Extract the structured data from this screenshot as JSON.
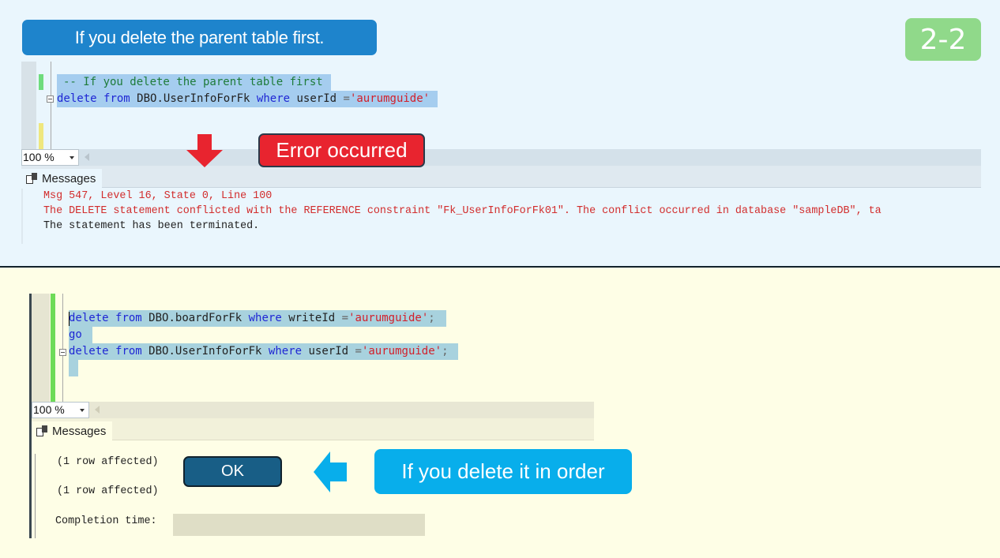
{
  "top": {
    "title": "If you delete the parent table first.",
    "page_badge": "2-2",
    "editor": {
      "line1_comment": "-- If you delete the parent table first",
      "line2": {
        "kw1": "delete",
        "kw2": "from",
        "table": "DBO.UserInfoForFk",
        "kw3": "where",
        "column": "userId",
        "op": "=",
        "value": "'aurumguide'"
      }
    },
    "zoom_level": "100 %",
    "messages_tab": "Messages",
    "messages": [
      {
        "text": "Msg 547, Level 16, State 0, Line 100",
        "type": "error"
      },
      {
        "text": "The DELETE statement conflicted with the REFERENCE constraint \"Fk_UserInfoForFk01\". The conflict occurred in database \"sampleDB\", ta",
        "type": "error"
      },
      {
        "text": "The statement has been terminated.",
        "type": "normal"
      }
    ],
    "callout": "Error occurred",
    "colors": {
      "banner": "#1e84cc",
      "badge": "#90d98a",
      "error": "#e8242f"
    }
  },
  "bottom": {
    "editor": {
      "line1": {
        "kw1": "delete",
        "kw2": "from",
        "table": "DBO.boardForFk",
        "kw3": "where",
        "column": "writeId",
        "op": "=",
        "value": "'aurumguide'",
        "end": ";"
      },
      "line2": "go",
      "line3": {
        "kw1": "delete",
        "kw2": "from",
        "table": "DBO.UserInfoForFk",
        "kw3": "where",
        "column": "userId",
        "op": "=",
        "value": "'aurumguide'",
        "end": ";"
      }
    },
    "zoom_level": "100 %",
    "messages_tab": "Messages",
    "messages": {
      "row1": "(1 row affected)",
      "row2": "(1 row affected)",
      "completion_label": "Completion time:"
    },
    "ok_label": "OK",
    "callout": "If you delete it in order",
    "colors": {
      "ok": "#185e86",
      "callout": "#08aeeb"
    }
  }
}
